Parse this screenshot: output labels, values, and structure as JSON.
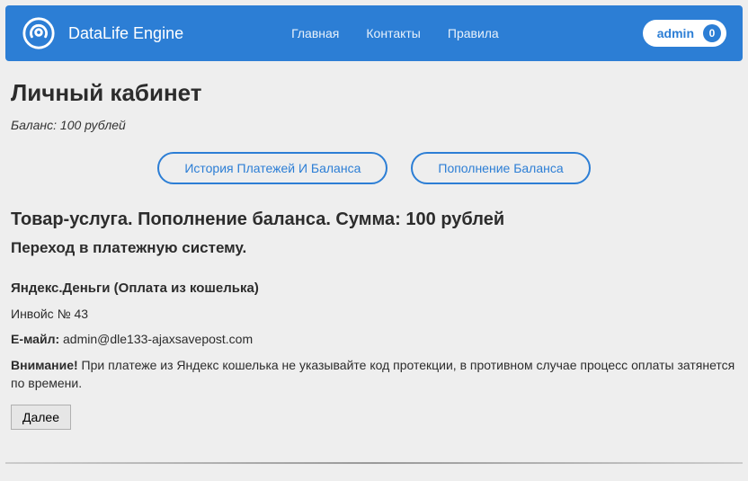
{
  "header": {
    "title": "DataLife Engine",
    "nav": {
      "home": "Главная",
      "contacts": "Контакты",
      "rules": "Правила"
    },
    "user": {
      "name": "admin",
      "badge": "0"
    }
  },
  "page": {
    "title": "Личный кабинет",
    "balance_line": "Баланс: 100 рублей",
    "tabs": {
      "history": "История Платежей И Баланса",
      "topup": "Пополнение Баланса"
    },
    "item_title": "Товар-услуга. Пополнение баланса. Сумма: 100 рублей",
    "subtitle": "Переход в платежную систему.",
    "payment_method": "Яндекс.Деньги (Оплата из кошелька)",
    "invoice": "Инвойс № 43",
    "email_label": "E-майл:",
    "email_value": "admin@dle133-ajaxsavepost.com",
    "warning_label": "Внимание!",
    "warning_text": "При платеже из Яндекс кошелька не указывайте код протекции, в противном случае процесс оплаты затянется по времени.",
    "proceed": "Далее"
  }
}
